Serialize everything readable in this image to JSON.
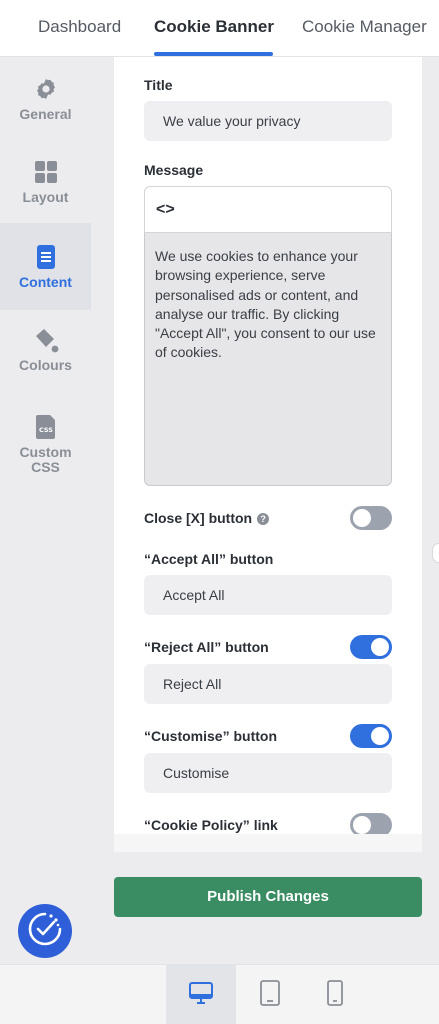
{
  "tabs": [
    {
      "label": "Dashboard",
      "active": false
    },
    {
      "label": "Cookie Banner",
      "active": true
    },
    {
      "label": "Cookie Manager",
      "active": false
    }
  ],
  "sidebar": {
    "items": [
      {
        "label": "General",
        "icon": "gear-icon",
        "active": false
      },
      {
        "label": "Layout",
        "icon": "grid-icon",
        "active": false
      },
      {
        "label": "Content",
        "icon": "document-icon",
        "active": true
      },
      {
        "label": "Colours",
        "icon": "paint-bucket-icon",
        "active": false
      },
      {
        "label": "Custom",
        "label2": "CSS",
        "icon": "css-file-icon",
        "active": false
      }
    ],
    "badge_icon": "cookie-check-icon"
  },
  "form": {
    "title_label": "Title",
    "title_value": "We value your privacy",
    "message_label": "Message",
    "message_toolbar_icon": "code-icon",
    "message_value": "We use cookies to enhance your browsing experience, serve personalised ads or content, and analyse our traffic. By clicking \"Accept All\", you consent to our use of cookies.",
    "close_label": "Close [X] button",
    "close_help_icon": "help-icon",
    "close_enabled": false,
    "accept_label": "“Accept All” button",
    "accept_value": "Accept All",
    "reject_label": "“Reject All” button",
    "reject_enabled": true,
    "reject_value": "Reject All",
    "customise_label": "“Customise” button",
    "customise_enabled": true,
    "customise_value": "Customise",
    "policy_label": "“Cookie Policy” link",
    "policy_enabled": false
  },
  "publish_label": "Publish Changes",
  "devices": [
    {
      "icon": "desktop-icon",
      "active": true
    },
    {
      "icon": "tablet-icon",
      "active": false
    },
    {
      "icon": "mobile-icon",
      "active": false
    }
  ],
  "colors": {
    "accent": "#2f6fde",
    "publish": "#3a8d62",
    "toggle_off": "#9da3ae"
  }
}
